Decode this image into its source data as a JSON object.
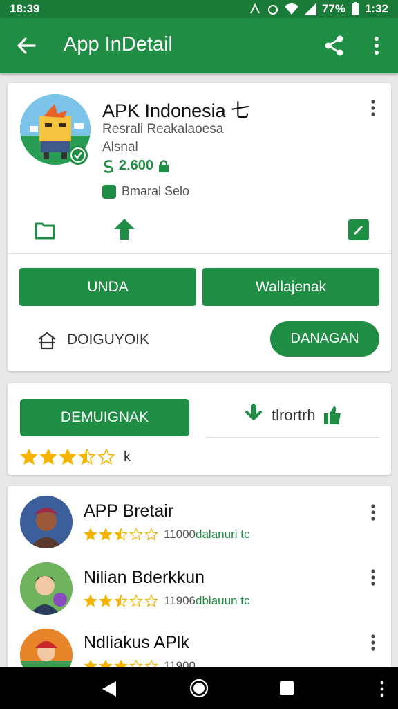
{
  "status_bar": {
    "time": "18:39",
    "battery": "77%",
    "clock": "1:32"
  },
  "app_bar": {
    "title": "App InDetail"
  },
  "app": {
    "name": "APK Indonesia 七",
    "developer": "Resrali Reakalaoesa",
    "category": "Alsnal",
    "price": "2.600",
    "badge": "Bmaral Selo"
  },
  "card1": {
    "primary_button": "UNDA",
    "secondary_button": "Wallajenak",
    "info_text": "DOIGUYOIK",
    "pill_button": "DANAGAN"
  },
  "card2": {
    "button": "DEMUIGNAK",
    "link_text": "tlrortrh",
    "rating_stars": 3.5,
    "rating_suffix": "k"
  },
  "related": [
    {
      "title": "APP Bretair",
      "rating": 2.5,
      "count": "11000",
      "label": "dalanuri tc"
    },
    {
      "title": "Nilian Bderkkun",
      "rating": 2.5,
      "count": "11906",
      "label": "dblauun tc"
    },
    {
      "title": "Ndliakus APlk",
      "rating": 3,
      "count": "11900",
      "label": ""
    }
  ],
  "colors": {
    "primary": "#1f8d43",
    "status_bar": "#1a7a38",
    "star": "#f5b400"
  },
  "icons": [
    "back-arrow-icon",
    "share-icon",
    "more-vert-icon",
    "verified-check-icon",
    "folder-icon",
    "arrow-up-icon",
    "edit-icon",
    "home-icon",
    "download-icon",
    "thumb-up-icon"
  ]
}
